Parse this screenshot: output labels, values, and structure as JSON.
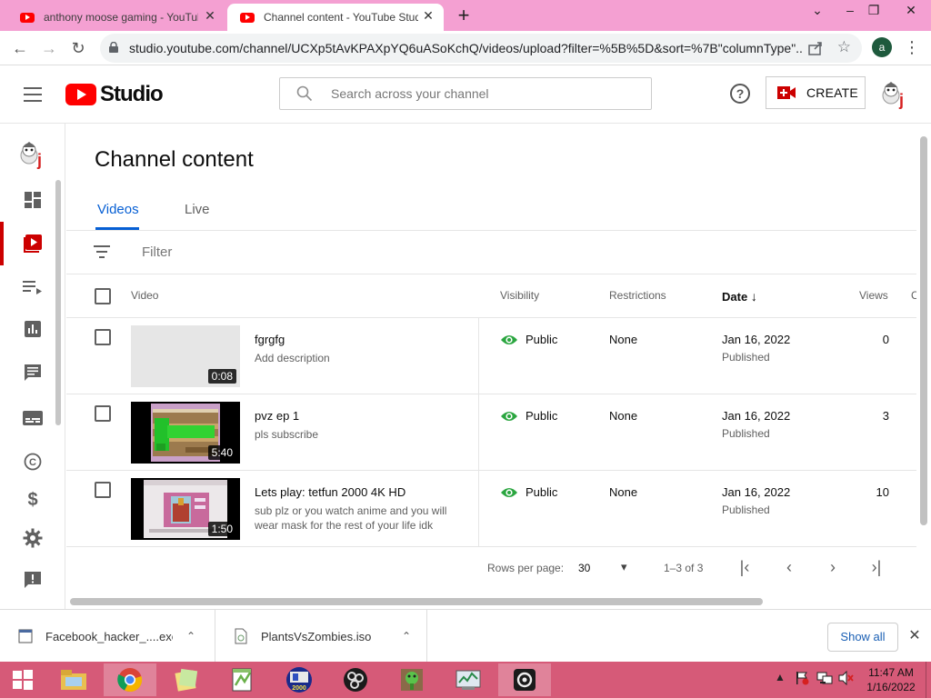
{
  "browser": {
    "tabs": [
      {
        "title": "anthony moose gaming - YouTube",
        "active": false
      },
      {
        "title": "Channel content - YouTube Studio",
        "active": true
      }
    ],
    "url": "studio.youtube.com/channel/UCXp5tAvKPAXpYQ6uASoKchQ/videos/upload?filter=%5B%5D&sort=%7B\"columnType\"...",
    "profile_initial": "a"
  },
  "header": {
    "logo_text": "Studio",
    "search_placeholder": "Search across your channel",
    "create_label": "CREATE"
  },
  "page": {
    "title": "Channel content",
    "tabs": [
      {
        "label": "Videos",
        "active": true
      },
      {
        "label": "Live",
        "active": false
      }
    ],
    "filter_placeholder": "Filter"
  },
  "table": {
    "columns": {
      "video": "Video",
      "visibility": "Visibility",
      "restrictions": "Restrictions",
      "date": "Date",
      "views": "Views",
      "extra": "C"
    },
    "rows": [
      {
        "title": "fgrgfg",
        "description": "Add description",
        "duration": "0:08",
        "visibility": "Public",
        "restrictions": "None",
        "date": "Jan 16, 2022",
        "status": "Published",
        "views": "0",
        "thumb": "blank"
      },
      {
        "title": "pvz ep 1",
        "description": "pls subscribe",
        "duration": "5:40",
        "visibility": "Public",
        "restrictions": "None",
        "date": "Jan 16, 2022",
        "status": "Published",
        "views": "3",
        "thumb": "pvz"
      },
      {
        "title": "Lets play: tetfun 2000 4K HD",
        "description": "sub plz or you watch anime and you will wear mask for the rest of your life idk",
        "duration": "1:50",
        "visibility": "Public",
        "restrictions": "None",
        "date": "Jan 16, 2022",
        "status": "Published",
        "views": "10",
        "thumb": "tetfun"
      }
    ]
  },
  "pagination": {
    "rows_per_page_label": "Rows per page:",
    "rows_per_page": "30",
    "range": "1–3 of 3"
  },
  "downloads": {
    "items": [
      {
        "name": "Facebook_hacker_....exe"
      },
      {
        "name": "PlantsVsZombies.iso"
      }
    ],
    "show_all_label": "Show all"
  },
  "taskbar": {
    "time": "11:47 AM",
    "date": "1/16/2022"
  },
  "colors": {
    "accent_blue": "#065fd4",
    "youtube_red": "#ff0000",
    "public_green": "#2ba640",
    "tab_strip_pink": "#f4a0d2",
    "taskbar_pink": "#d65a78"
  }
}
